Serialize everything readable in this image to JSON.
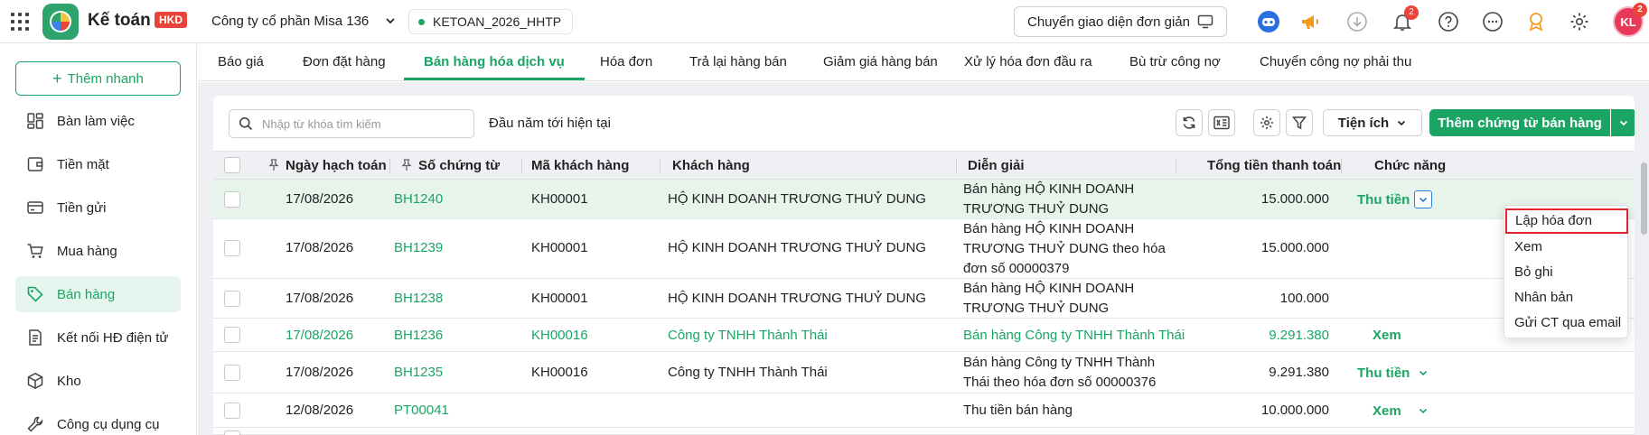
{
  "topbar": {
    "app_name": "Kế toán",
    "badge": "HKD",
    "company": "Công ty cổ phần Misa 136",
    "database": "KETOAN_2026_HHTP",
    "switch_ui_label": "Chuyển giao diện đơn giản",
    "notification_count": "2",
    "avatar_initials": "KL",
    "avatar_count": "2"
  },
  "sidebar": {
    "quick_add": "Thêm nhanh",
    "items": [
      {
        "label": "Bàn làm việc",
        "icon": "dashboard-icon"
      },
      {
        "label": "Tiền mặt",
        "icon": "cash-icon"
      },
      {
        "label": "Tiền gửi",
        "icon": "bank-card-icon"
      },
      {
        "label": "Mua hàng",
        "icon": "cart-icon"
      },
      {
        "label": "Bán hàng",
        "icon": "tag-icon"
      },
      {
        "label": "Kết nối HĐ điện tử",
        "icon": "e-invoice-icon"
      },
      {
        "label": "Kho",
        "icon": "box-icon"
      },
      {
        "label": "Công cụ dụng cụ",
        "icon": "tools-icon"
      }
    ]
  },
  "tabs": [
    "Báo giá",
    "Đơn đặt hàng",
    "Bán hàng hóa dịch vụ",
    "Hóa đơn",
    "Trả lại hàng bán",
    "Giảm giá hàng bán",
    "Xử lý hóa đơn đầu ra",
    "Bù trừ công nợ",
    "Chuyển công nợ phải thu"
  ],
  "toolbar": {
    "search_placeholder": "Nhập từ khóa tìm kiếm",
    "period": "Đầu năm tới hiện tại",
    "utilities": "Tiện ích",
    "add_doc": "Thêm chứng từ bán hàng"
  },
  "table": {
    "columns": [
      "Ngày hạch toán",
      "Số chứng từ",
      "Mã khách hàng",
      "Khách hàng",
      "Diễn giải",
      "Tổng tiền thanh toán",
      "Chức năng"
    ],
    "rows": [
      {
        "date": "17/08/2026",
        "doc": "BH1240",
        "code": "KH00001",
        "customer": "HỘ KINH DOANH TRƯƠNG THUỶ DUNG",
        "desc": "Bán hàng HỘ KINH DOANH TRƯƠNG THUỶ DUNG",
        "total": "15.000.000",
        "action": "Thu tiền"
      },
      {
        "date": "17/08/2026",
        "doc": "BH1239",
        "code": "KH00001",
        "customer": "HỘ KINH DOANH TRƯƠNG THUỶ DUNG",
        "desc": "Bán hàng HỘ KINH DOANH TRƯƠNG THUỶ DUNG theo hóa đơn số 00000379",
        "total": "15.000.000",
        "action": ""
      },
      {
        "date": "17/08/2026",
        "doc": "BH1238",
        "code": "KH00001",
        "customer": "HỘ KINH DOANH TRƯƠNG THUỶ DUNG",
        "desc": "Bán hàng HỘ KINH DOANH TRƯƠNG THUỶ DUNG",
        "total": "100.000",
        "action": ""
      },
      {
        "date": "17/08/2026",
        "doc": "BH1236",
        "code": "KH00016",
        "customer": "Công ty TNHH Thành Thái",
        "desc": "Bán hàng Công ty TNHH Thành Thái",
        "total": "9.291.380",
        "action": "Xem"
      },
      {
        "date": "17/08/2026",
        "doc": "BH1235",
        "code": "KH00016",
        "customer": "Công ty TNHH Thành Thái",
        "desc": "Bán hàng Công ty TNHH Thành Thái theo hóa đơn số 00000376",
        "total": "9.291.380",
        "action": "Thu tiền"
      },
      {
        "date": "12/08/2026",
        "doc": "PT00041",
        "code": "",
        "customer": "",
        "desc": "Thu tiền bán hàng",
        "total": "10.000.000",
        "action": "Xem"
      }
    ]
  },
  "menu": [
    "Lập hóa đơn",
    "Xem",
    "Bỏ ghi",
    "Nhân bản",
    "Gửi CT qua email"
  ],
  "colors": {
    "accent": "#1aa564",
    "highlight_row": "#e7f4ec",
    "focus_border": "#e0262b"
  }
}
